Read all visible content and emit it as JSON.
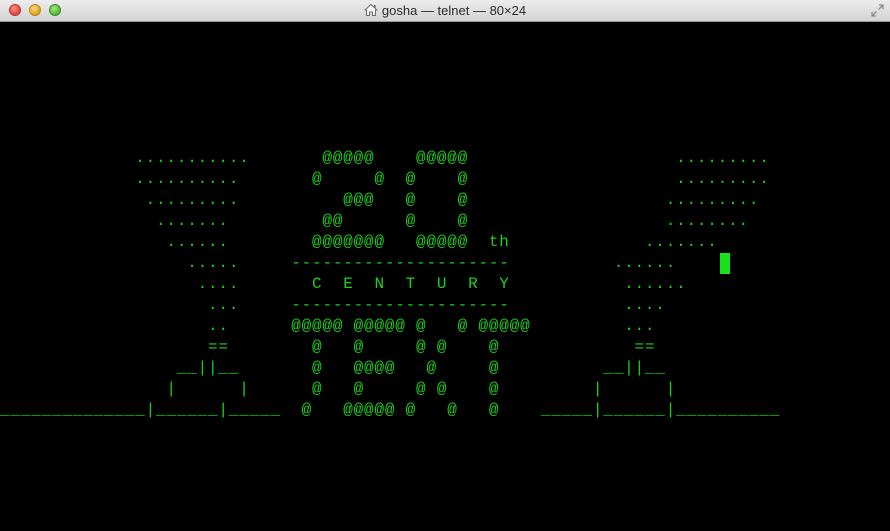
{
  "window": {
    "title": "gosha — telnet — 80×24",
    "icon": "home-icon"
  },
  "terminal": {
    "fg_color": "#1fd11f",
    "bg_color": "#000000",
    "lines": [
      "             ...........       @@@@@    @@@@@                    .........",
      "             ..........       @     @  @    @                    .........",
      "              .........          @@@   @    @                   .........",
      "               .......         @@      @    @                   ........",
      "                ......        @@@@@@@   @@@@@  th             .......",
      "                  .....     ---------------------          ......",
      "                   ....       C  E  N  T  U  R  Y           ......",
      "                    ...     ---------------------           ....",
      "                    ..      @@@@@ @@@@@ @   @ @@@@@         ...",
      "                    ==        @   @     @ @    @             ==",
      "                 __||__       @   @@@@   @     @          __||__",
      "                |      |      @   @     @ @    @         |      |",
      "______________|______|_____  @   @@@@@ @   @   @    _____|______|__________"
    ]
  }
}
